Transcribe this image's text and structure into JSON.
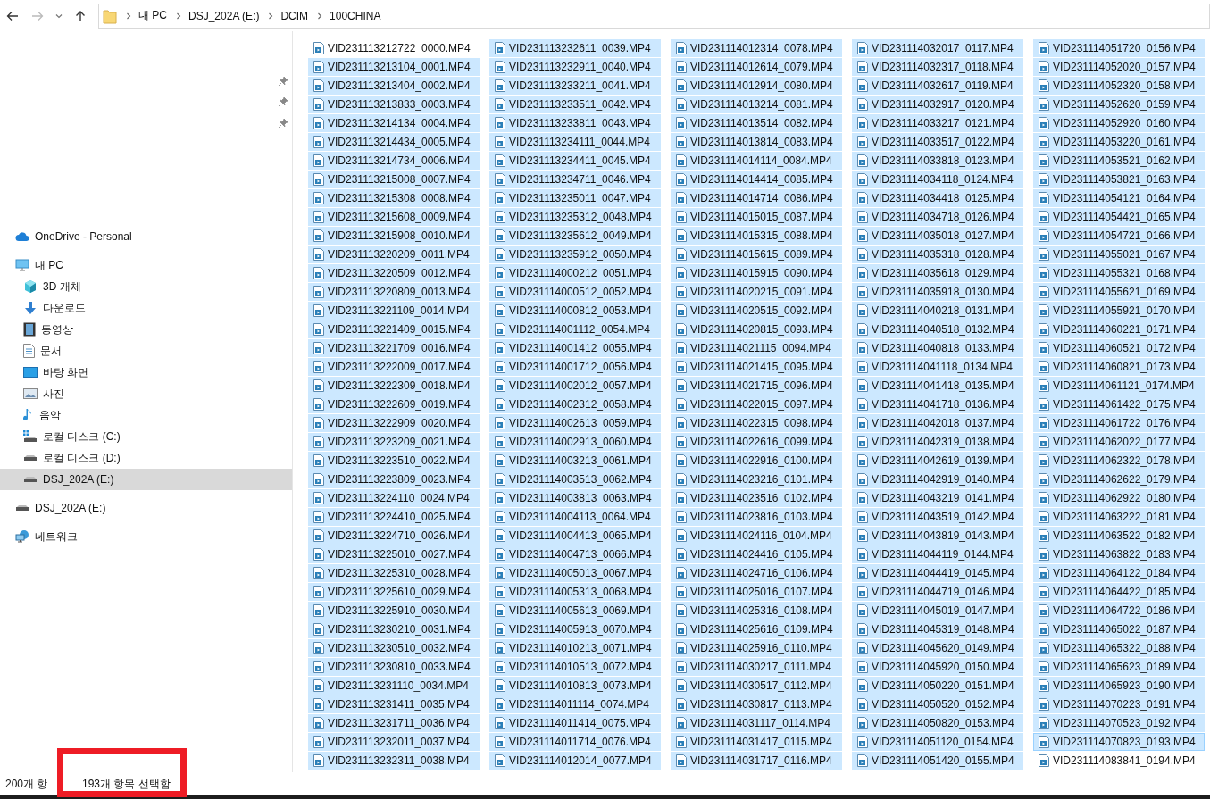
{
  "address_bar": {
    "segments": [
      "내 PC",
      "DSJ_202A (E:)",
      "DCIM",
      "100CHINA"
    ]
  },
  "sidebar": {
    "pinned": [
      {
        "pinned": true
      },
      {
        "pinned": true
      },
      {
        "pinned": true
      }
    ],
    "tree": [
      {
        "label": "OneDrive - Personal",
        "kind": "cloud",
        "selected": false
      },
      {
        "label": "내 PC",
        "kind": "pc",
        "selected": false,
        "children": [
          {
            "label": "3D 개체",
            "kind": "cube",
            "selected": false
          },
          {
            "label": "다운로드",
            "kind": "download",
            "selected": false
          },
          {
            "label": "동영상",
            "kind": "film",
            "selected": false
          },
          {
            "label": "문서",
            "kind": "document",
            "selected": false
          },
          {
            "label": "바탕 화면",
            "kind": "desktop",
            "selected": false
          },
          {
            "label": "사진",
            "kind": "picture",
            "selected": false
          },
          {
            "label": "음악",
            "kind": "music",
            "selected": false
          },
          {
            "label": "로컬 디스크 (C:)",
            "kind": "system-drive",
            "selected": false
          },
          {
            "label": "로컬 디스크 (D:)",
            "kind": "drive",
            "selected": false
          },
          {
            "label": "DSJ_202A (E:)",
            "kind": "drive",
            "selected": true
          }
        ]
      },
      {
        "label": "DSJ_202A (E:)",
        "kind": "drive",
        "selected": false
      },
      {
        "label": "네트워크",
        "kind": "network",
        "selected": false
      }
    ]
  },
  "files": [
    {
      "name": "VID231113212722_0000.MP4",
      "selected": false,
      "focused": false
    },
    {
      "name": "VID231113213104_0001.MP4",
      "selected": true,
      "focused": false
    },
    {
      "name": "VID231113213404_0002.MP4",
      "selected": true,
      "focused": false
    },
    {
      "name": "VID231113213833_0003.MP4",
      "selected": true,
      "focused": false
    },
    {
      "name": "VID231113214134_0004.MP4",
      "selected": true,
      "focused": false
    },
    {
      "name": "VID231113214434_0005.MP4",
      "selected": true,
      "focused": false
    },
    {
      "name": "VID231113214734_0006.MP4",
      "selected": true,
      "focused": false
    },
    {
      "name": "VID231113215008_0007.MP4",
      "selected": true,
      "focused": false
    },
    {
      "name": "VID231113215308_0008.MP4",
      "selected": true,
      "focused": false
    },
    {
      "name": "VID231113215608_0009.MP4",
      "selected": true,
      "focused": false
    },
    {
      "name": "VID231113215908_0010.MP4",
      "selected": true,
      "focused": false
    },
    {
      "name": "VID231113220209_0011.MP4",
      "selected": true,
      "focused": false
    },
    {
      "name": "VID231113220509_0012.MP4",
      "selected": true,
      "focused": false
    },
    {
      "name": "VID231113220809_0013.MP4",
      "selected": true,
      "focused": false
    },
    {
      "name": "VID231113221109_0014.MP4",
      "selected": true,
      "focused": false
    },
    {
      "name": "VID231113221409_0015.MP4",
      "selected": true,
      "focused": false
    },
    {
      "name": "VID231113221709_0016.MP4",
      "selected": true,
      "focused": false
    },
    {
      "name": "VID231113222009_0017.MP4",
      "selected": true,
      "focused": false
    },
    {
      "name": "VID231113222309_0018.MP4",
      "selected": true,
      "focused": false
    },
    {
      "name": "VID231113222609_0019.MP4",
      "selected": true,
      "focused": false
    },
    {
      "name": "VID231113222909_0020.MP4",
      "selected": true,
      "focused": false
    },
    {
      "name": "VID231113223209_0021.MP4",
      "selected": true,
      "focused": false
    },
    {
      "name": "VID231113223510_0022.MP4",
      "selected": true,
      "focused": false
    },
    {
      "name": "VID231113223809_0023.MP4",
      "selected": true,
      "focused": false
    },
    {
      "name": "VID231113224110_0024.MP4",
      "selected": true,
      "focused": false
    },
    {
      "name": "VID231113224410_0025.MP4",
      "selected": true,
      "focused": false
    },
    {
      "name": "VID231113224710_0026.MP4",
      "selected": true,
      "focused": false
    },
    {
      "name": "VID231113225010_0027.MP4",
      "selected": true,
      "focused": false
    },
    {
      "name": "VID231113225310_0028.MP4",
      "selected": true,
      "focused": false
    },
    {
      "name": "VID231113225610_0029.MP4",
      "selected": true,
      "focused": false
    },
    {
      "name": "VID231113225910_0030.MP4",
      "selected": true,
      "focused": false
    },
    {
      "name": "VID231113230210_0031.MP4",
      "selected": true,
      "focused": false
    },
    {
      "name": "VID231113230510_0032.MP4",
      "selected": true,
      "focused": false
    },
    {
      "name": "VID231113230810_0033.MP4",
      "selected": true,
      "focused": false
    },
    {
      "name": "VID231113231110_0034.MP4",
      "selected": true,
      "focused": false
    },
    {
      "name": "VID231113231411_0035.MP4",
      "selected": true,
      "focused": false
    },
    {
      "name": "VID231113231711_0036.MP4",
      "selected": true,
      "focused": false
    },
    {
      "name": "VID231113232011_0037.MP4",
      "selected": true,
      "focused": false
    },
    {
      "name": "VID231113232311_0038.MP4",
      "selected": true,
      "focused": false
    },
    {
      "name": "VID231113232611_0039.MP4",
      "selected": true,
      "focused": false
    },
    {
      "name": "VID231113232911_0040.MP4",
      "selected": true,
      "focused": false
    },
    {
      "name": "VID231113233211_0041.MP4",
      "selected": true,
      "focused": false
    },
    {
      "name": "VID231113233511_0042.MP4",
      "selected": true,
      "focused": false
    },
    {
      "name": "VID231113233811_0043.MP4",
      "selected": true,
      "focused": false
    },
    {
      "name": "VID231113234111_0044.MP4",
      "selected": true,
      "focused": false
    },
    {
      "name": "VID231113234411_0045.MP4",
      "selected": true,
      "focused": false
    },
    {
      "name": "VID231113234711_0046.MP4",
      "selected": true,
      "focused": false
    },
    {
      "name": "VID231113235011_0047.MP4",
      "selected": true,
      "focused": false
    },
    {
      "name": "VID231113235312_0048.MP4",
      "selected": true,
      "focused": false
    },
    {
      "name": "VID231113235612_0049.MP4",
      "selected": true,
      "focused": false
    },
    {
      "name": "VID231113235912_0050.MP4",
      "selected": true,
      "focused": false
    },
    {
      "name": "VID231114000212_0051.MP4",
      "selected": true,
      "focused": false
    },
    {
      "name": "VID231114000512_0052.MP4",
      "selected": true,
      "focused": false
    },
    {
      "name": "VID231114000812_0053.MP4",
      "selected": true,
      "focused": false
    },
    {
      "name": "VID231114001112_0054.MP4",
      "selected": true,
      "focused": false
    },
    {
      "name": "VID231114001412_0055.MP4",
      "selected": true,
      "focused": false
    },
    {
      "name": "VID231114001712_0056.MP4",
      "selected": true,
      "focused": false
    },
    {
      "name": "VID231114002012_0057.MP4",
      "selected": true,
      "focused": false
    },
    {
      "name": "VID231114002312_0058.MP4",
      "selected": true,
      "focused": false
    },
    {
      "name": "VID231114002613_0059.MP4",
      "selected": true,
      "focused": false
    },
    {
      "name": "VID231114002913_0060.MP4",
      "selected": true,
      "focused": false
    },
    {
      "name": "VID231114003213_0061.MP4",
      "selected": true,
      "focused": false
    },
    {
      "name": "VID231114003513_0062.MP4",
      "selected": true,
      "focused": false
    },
    {
      "name": "VID231114003813_0063.MP4",
      "selected": true,
      "focused": false
    },
    {
      "name": "VID231114004113_0064.MP4",
      "selected": true,
      "focused": false
    },
    {
      "name": "VID231114004413_0065.MP4",
      "selected": true,
      "focused": false
    },
    {
      "name": "VID231114004713_0066.MP4",
      "selected": true,
      "focused": false
    },
    {
      "name": "VID231114005013_0067.MP4",
      "selected": true,
      "focused": false
    },
    {
      "name": "VID231114005313_0068.MP4",
      "selected": true,
      "focused": false
    },
    {
      "name": "VID231114005613_0069.MP4",
      "selected": true,
      "focused": false
    },
    {
      "name": "VID231114005913_0070.MP4",
      "selected": true,
      "focused": false
    },
    {
      "name": "VID231114010213_0071.MP4",
      "selected": true,
      "focused": false
    },
    {
      "name": "VID231114010513_0072.MP4",
      "selected": true,
      "focused": false
    },
    {
      "name": "VID231114010813_0073.MP4",
      "selected": true,
      "focused": false
    },
    {
      "name": "VID231114011114_0074.MP4",
      "selected": true,
      "focused": false
    },
    {
      "name": "VID231114011414_0075.MP4",
      "selected": true,
      "focused": false
    },
    {
      "name": "VID231114011714_0076.MP4",
      "selected": true,
      "focused": false
    },
    {
      "name": "VID231114012014_0077.MP4",
      "selected": true,
      "focused": false
    },
    {
      "name": "VID231114012314_0078.MP4",
      "selected": true,
      "focused": false
    },
    {
      "name": "VID231114012614_0079.MP4",
      "selected": true,
      "focused": false
    },
    {
      "name": "VID231114012914_0080.MP4",
      "selected": true,
      "focused": false
    },
    {
      "name": "VID231114013214_0081.MP4",
      "selected": true,
      "focused": false
    },
    {
      "name": "VID231114013514_0082.MP4",
      "selected": true,
      "focused": false
    },
    {
      "name": "VID231114013814_0083.MP4",
      "selected": true,
      "focused": false
    },
    {
      "name": "VID231114014114_0084.MP4",
      "selected": true,
      "focused": false
    },
    {
      "name": "VID231114014414_0085.MP4",
      "selected": true,
      "focused": false
    },
    {
      "name": "VID231114014714_0086.MP4",
      "selected": true,
      "focused": false
    },
    {
      "name": "VID231114015015_0087.MP4",
      "selected": true,
      "focused": false
    },
    {
      "name": "VID231114015315_0088.MP4",
      "selected": true,
      "focused": false
    },
    {
      "name": "VID231114015615_0089.MP4",
      "selected": true,
      "focused": false
    },
    {
      "name": "VID231114015915_0090.MP4",
      "selected": true,
      "focused": false
    },
    {
      "name": "VID231114020215_0091.MP4",
      "selected": true,
      "focused": false
    },
    {
      "name": "VID231114020515_0092.MP4",
      "selected": true,
      "focused": false
    },
    {
      "name": "VID231114020815_0093.MP4",
      "selected": true,
      "focused": false
    },
    {
      "name": "VID231114021115_0094.MP4",
      "selected": true,
      "focused": false
    },
    {
      "name": "VID231114021415_0095.MP4",
      "selected": true,
      "focused": false
    },
    {
      "name": "VID231114021715_0096.MP4",
      "selected": true,
      "focused": false
    },
    {
      "name": "VID231114022015_0097.MP4",
      "selected": true,
      "focused": false
    },
    {
      "name": "VID231114022315_0098.MP4",
      "selected": true,
      "focused": false
    },
    {
      "name": "VID231114022616_0099.MP4",
      "selected": true,
      "focused": false
    },
    {
      "name": "VID231114022916_0100.MP4",
      "selected": true,
      "focused": false
    },
    {
      "name": "VID231114023216_0101.MP4",
      "selected": true,
      "focused": false
    },
    {
      "name": "VID231114023516_0102.MP4",
      "selected": true,
      "focused": false
    },
    {
      "name": "VID231114023816_0103.MP4",
      "selected": true,
      "focused": false
    },
    {
      "name": "VID231114024116_0104.MP4",
      "selected": true,
      "focused": false
    },
    {
      "name": "VID231114024416_0105.MP4",
      "selected": true,
      "focused": false
    },
    {
      "name": "VID231114024716_0106.MP4",
      "selected": true,
      "focused": false
    },
    {
      "name": "VID231114025016_0107.MP4",
      "selected": true,
      "focused": false
    },
    {
      "name": "VID231114025316_0108.MP4",
      "selected": true,
      "focused": false
    },
    {
      "name": "VID231114025616_0109.MP4",
      "selected": true,
      "focused": false
    },
    {
      "name": "VID231114025916_0110.MP4",
      "selected": true,
      "focused": false
    },
    {
      "name": "VID231114030217_0111.MP4",
      "selected": true,
      "focused": false
    },
    {
      "name": "VID231114030517_0112.MP4",
      "selected": true,
      "focused": false
    },
    {
      "name": "VID231114030817_0113.MP4",
      "selected": true,
      "focused": false
    },
    {
      "name": "VID231114031117_0114.MP4",
      "selected": true,
      "focused": false
    },
    {
      "name": "VID231114031417_0115.MP4",
      "selected": true,
      "focused": false
    },
    {
      "name": "VID231114031717_0116.MP4",
      "selected": true,
      "focused": false
    },
    {
      "name": "VID231114032017_0117.MP4",
      "selected": true,
      "focused": false
    },
    {
      "name": "VID231114032317_0118.MP4",
      "selected": true,
      "focused": false
    },
    {
      "name": "VID231114032617_0119.MP4",
      "selected": true,
      "focused": false
    },
    {
      "name": "VID231114032917_0120.MP4",
      "selected": true,
      "focused": false
    },
    {
      "name": "VID231114033217_0121.MP4",
      "selected": true,
      "focused": false
    },
    {
      "name": "VID231114033517_0122.MP4",
      "selected": true,
      "focused": false
    },
    {
      "name": "VID231114033818_0123.MP4",
      "selected": true,
      "focused": false
    },
    {
      "name": "VID231114034118_0124.MP4",
      "selected": true,
      "focused": false
    },
    {
      "name": "VID231114034418_0125.MP4",
      "selected": true,
      "focused": false
    },
    {
      "name": "VID231114034718_0126.MP4",
      "selected": true,
      "focused": false
    },
    {
      "name": "VID231114035018_0127.MP4",
      "selected": true,
      "focused": false
    },
    {
      "name": "VID231114035318_0128.MP4",
      "selected": true,
      "focused": false
    },
    {
      "name": "VID231114035618_0129.MP4",
      "selected": true,
      "focused": false
    },
    {
      "name": "VID231114035918_0130.MP4",
      "selected": true,
      "focused": false
    },
    {
      "name": "VID231114040218_0131.MP4",
      "selected": true,
      "focused": false
    },
    {
      "name": "VID231114040518_0132.MP4",
      "selected": true,
      "focused": false
    },
    {
      "name": "VID231114040818_0133.MP4",
      "selected": true,
      "focused": false
    },
    {
      "name": "VID231114041118_0134.MP4",
      "selected": true,
      "focused": false
    },
    {
      "name": "VID231114041418_0135.MP4",
      "selected": true,
      "focused": false
    },
    {
      "name": "VID231114041718_0136.MP4",
      "selected": true,
      "focused": false
    },
    {
      "name": "VID231114042018_0137.MP4",
      "selected": true,
      "focused": false
    },
    {
      "name": "VID231114042319_0138.MP4",
      "selected": true,
      "focused": false
    },
    {
      "name": "VID231114042619_0139.MP4",
      "selected": true,
      "focused": false
    },
    {
      "name": "VID231114042919_0140.MP4",
      "selected": true,
      "focused": false
    },
    {
      "name": "VID231114043219_0141.MP4",
      "selected": true,
      "focused": false
    },
    {
      "name": "VID231114043519_0142.MP4",
      "selected": true,
      "focused": false
    },
    {
      "name": "VID231114043819_0143.MP4",
      "selected": true,
      "focused": false
    },
    {
      "name": "VID231114044119_0144.MP4",
      "selected": true,
      "focused": false
    },
    {
      "name": "VID231114044419_0145.MP4",
      "selected": true,
      "focused": false
    },
    {
      "name": "VID231114044719_0146.MP4",
      "selected": true,
      "focused": false
    },
    {
      "name": "VID231114045019_0147.MP4",
      "selected": true,
      "focused": false
    },
    {
      "name": "VID231114045319_0148.MP4",
      "selected": true,
      "focused": false
    },
    {
      "name": "VID231114045620_0149.MP4",
      "selected": true,
      "focused": false
    },
    {
      "name": "VID231114045920_0150.MP4",
      "selected": true,
      "focused": false
    },
    {
      "name": "VID231114050220_0151.MP4",
      "selected": true,
      "focused": false
    },
    {
      "name": "VID231114050520_0152.MP4",
      "selected": true,
      "focused": false
    },
    {
      "name": "VID231114050820_0153.MP4",
      "selected": true,
      "focused": false
    },
    {
      "name": "VID231114051120_0154.MP4",
      "selected": true,
      "focused": false
    },
    {
      "name": "VID231114051420_0155.MP4",
      "selected": true,
      "focused": false
    },
    {
      "name": "VID231114051720_0156.MP4",
      "selected": true,
      "focused": false
    },
    {
      "name": "VID231114052020_0157.MP4",
      "selected": true,
      "focused": false
    },
    {
      "name": "VID231114052320_0158.MP4",
      "selected": true,
      "focused": false
    },
    {
      "name": "VID231114052620_0159.MP4",
      "selected": true,
      "focused": false
    },
    {
      "name": "VID231114052920_0160.MP4",
      "selected": true,
      "focused": false
    },
    {
      "name": "VID231114053220_0161.MP4",
      "selected": true,
      "focused": false
    },
    {
      "name": "VID231114053521_0162.MP4",
      "selected": true,
      "focused": false
    },
    {
      "name": "VID231114053821_0163.MP4",
      "selected": true,
      "focused": false
    },
    {
      "name": "VID231114054121_0164.MP4",
      "selected": true,
      "focused": false
    },
    {
      "name": "VID231114054421_0165.MP4",
      "selected": true,
      "focused": false
    },
    {
      "name": "VID231114054721_0166.MP4",
      "selected": true,
      "focused": false
    },
    {
      "name": "VID231114055021_0167.MP4",
      "selected": true,
      "focused": false
    },
    {
      "name": "VID231114055321_0168.MP4",
      "selected": true,
      "focused": false
    },
    {
      "name": "VID231114055621_0169.MP4",
      "selected": true,
      "focused": false
    },
    {
      "name": "VID231114055921_0170.MP4",
      "selected": true,
      "focused": false
    },
    {
      "name": "VID231114060221_0171.MP4",
      "selected": true,
      "focused": false
    },
    {
      "name": "VID231114060521_0172.MP4",
      "selected": true,
      "focused": false
    },
    {
      "name": "VID231114060821_0173.MP4",
      "selected": true,
      "focused": false
    },
    {
      "name": "VID231114061121_0174.MP4",
      "selected": true,
      "focused": false
    },
    {
      "name": "VID231114061422_0175.MP4",
      "selected": true,
      "focused": false
    },
    {
      "name": "VID231114061722_0176.MP4",
      "selected": true,
      "focused": false
    },
    {
      "name": "VID231114062022_0177.MP4",
      "selected": true,
      "focused": false
    },
    {
      "name": "VID231114062322_0178.MP4",
      "selected": true,
      "focused": false
    },
    {
      "name": "VID231114062622_0179.MP4",
      "selected": true,
      "focused": false
    },
    {
      "name": "VID231114062922_0180.MP4",
      "selected": true,
      "focused": false
    },
    {
      "name": "VID231114063222_0181.MP4",
      "selected": true,
      "focused": false
    },
    {
      "name": "VID231114063522_0182.MP4",
      "selected": true,
      "focused": false
    },
    {
      "name": "VID231114063822_0183.MP4",
      "selected": true,
      "focused": false
    },
    {
      "name": "VID231114064122_0184.MP4",
      "selected": true,
      "focused": false
    },
    {
      "name": "VID231114064422_0185.MP4",
      "selected": true,
      "focused": false
    },
    {
      "name": "VID231114064722_0186.MP4",
      "selected": true,
      "focused": false
    },
    {
      "name": "VID231114065022_0187.MP4",
      "selected": true,
      "focused": false
    },
    {
      "name": "VID231114065322_0188.MP4",
      "selected": true,
      "focused": false
    },
    {
      "name": "VID231114065623_0189.MP4",
      "selected": true,
      "focused": false
    },
    {
      "name": "VID231114065923_0190.MP4",
      "selected": true,
      "focused": false
    },
    {
      "name": "VID231114070223_0191.MP4",
      "selected": true,
      "focused": false
    },
    {
      "name": "VID231114070523_0192.MP4",
      "selected": true,
      "focused": false
    },
    {
      "name": "VID231114070823_0193.MP4",
      "selected": true,
      "focused": true
    },
    {
      "name": "VID231114083841_0194.MP4",
      "selected": false,
      "focused": false
    }
  ],
  "status_bar": {
    "item_count": "200개 항",
    "selection_count": "193개 항목 선택함"
  }
}
